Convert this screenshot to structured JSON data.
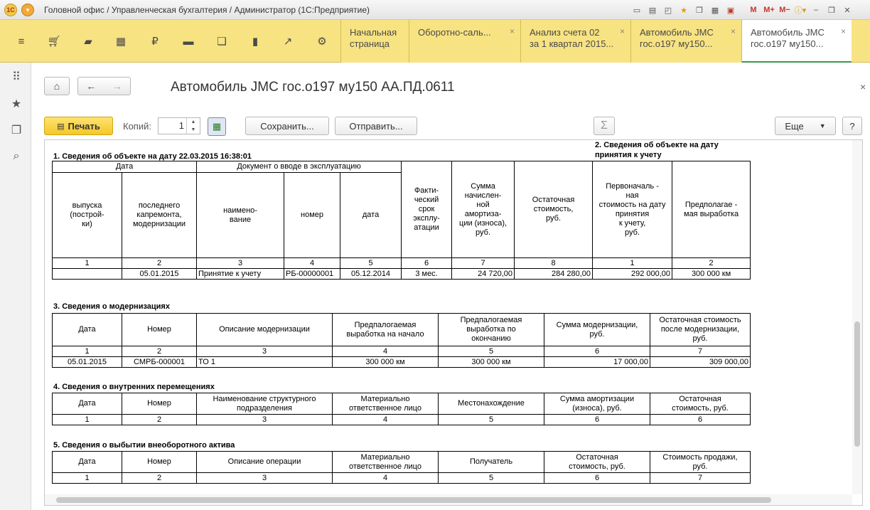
{
  "app": {
    "window_title": "Головной офис / Управленческая бухгалтерия / Администратор  (1С:Предприятие)",
    "logo": "1С"
  },
  "titlebar_icons": [
    "monitor-icon",
    "print-icon",
    "preview-icon",
    "star-icon",
    "window-icon",
    "calculator-icon",
    "calendar-icon",
    "M",
    "M+",
    "M−",
    "info-icon",
    "minimize-icon",
    "restore-icon",
    "close-icon"
  ],
  "tabs": [
    {
      "label": "Начальная\nстраница",
      "closable": false
    },
    {
      "label": "Оборотно-саль...",
      "closable": true
    },
    {
      "label": "Анализ счета 02\nза 1 квартал 2015...",
      "closable": true
    },
    {
      "label": "Автомобиль JMC\nгос.о197 му150...",
      "closable": true
    },
    {
      "label": "Автомобиль JMC\nгос.о197 му150...",
      "closable": true,
      "active": true
    }
  ],
  "form": {
    "title": "Автомобиль JMC гос.о197 му150 АА.ПД.0611",
    "print_label": "Печать",
    "copies_label": "Копий:",
    "copies_value": "1",
    "save_label": "Сохранить...",
    "send_label": "Отправить...",
    "sum_label": "Σ",
    "more_label": "Еще",
    "help_label": "?"
  },
  "report": {
    "s1": {
      "title": "1. Сведения об объекте на дату 22.03.2015 16:38:01",
      "date_group": "Дата",
      "doc_group": "Документ о вводе в эксплуатацию",
      "h_issue": "выпуска\n(построй-\nки)",
      "h_repair": "последнего\nкапремонта,\nмодернизации",
      "h_name": "наимено-\nвание",
      "h_number": "номер",
      "h_date": "дата",
      "h_term": "Факти-\nческий\nсрок\nэксплу-\nатации",
      "h_amort": "Сумма\nначислен-\nной\nамортиза-\nции (износа),\nруб.",
      "h_residual": "Остаточная\nстоимость,\nруб.",
      "nums": [
        "1",
        "2",
        "3",
        "4",
        "5",
        "6",
        "7",
        "8"
      ],
      "row": {
        "issue": "",
        "repair": "05.01.2015",
        "name": "Принятие к учету",
        "number": "РБ-00000001",
        "date": "05.12.2014",
        "term": "3 мес.",
        "amort": "24 720,00",
        "residual": "284 280,00"
      }
    },
    "s2": {
      "title": "2. Сведения об объекте на дату\nпринятия к учету",
      "h_initial": "Первоначаль -\nная\nстоимость на дату\nпринятия\nк учету,\nруб.",
      "h_output": "Предполагае -\nмая выработка",
      "nums": [
        "1",
        "2"
      ],
      "row": {
        "initial": "292 000,00",
        "output": "300 000 км"
      }
    },
    "s3": {
      "title": "3. Сведения о модернизациях",
      "headers": [
        "Дата",
        "Номер",
        "Описание модернизации",
        "Предпалогаемая\nвыработка на начало",
        "Предпалогаемая\nвыработка по\nокончанию",
        "Сумма модернизации,\nруб.",
        "Остаточная стоимость\nпосле модернизации,\nруб."
      ],
      "nums": [
        "1",
        "2",
        "3",
        "4",
        "5",
        "6",
        "7"
      ],
      "row": [
        "05.01.2015",
        "СМРБ-000001",
        "ТО 1",
        "300 000 км",
        "300 000 км",
        "17 000,00",
        "309 000,00"
      ]
    },
    "s4": {
      "title": "4. Сведения о внутренних перемещениях",
      "headers": [
        "Дата",
        "Номер",
        "Наименование структурного\nподразделения",
        "Материально\nответственное лицо",
        "Местонахождение",
        "Сумма амортизации\n(износа), руб.",
        "Остаточная\nстоимость, руб."
      ],
      "nums": [
        "1",
        "2",
        "3",
        "4",
        "5",
        "6",
        "6"
      ]
    },
    "s5": {
      "title": "5. Сведения о выбытии внеоборотного актива",
      "headers": [
        "Дата",
        "Номер",
        "Описание операции",
        "Материально\nответственное лицо",
        "Получатель",
        "Остаточная\nстоимость, руб.",
        "Стоимость продажи,\nруб."
      ],
      "nums": [
        "1",
        "2",
        "3",
        "4",
        "5",
        "6",
        "7"
      ]
    }
  }
}
